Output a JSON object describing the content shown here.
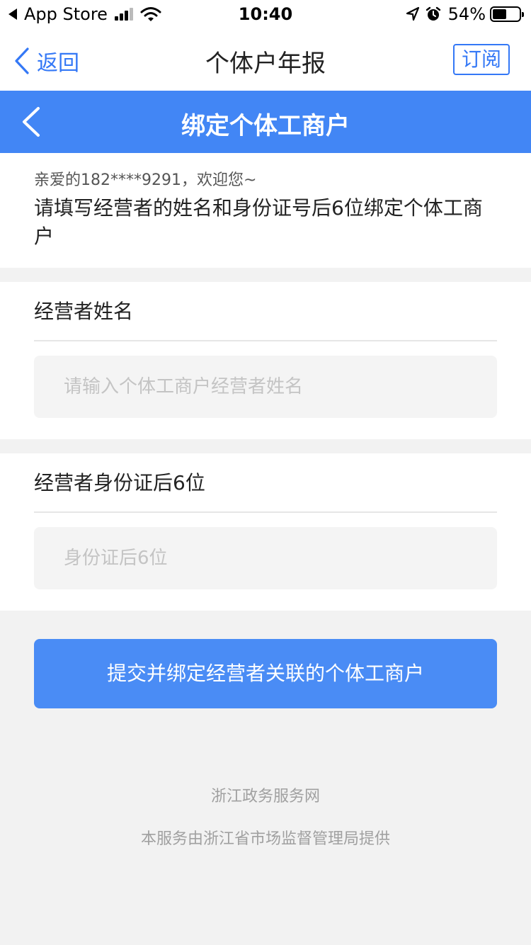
{
  "status_bar": {
    "back_app": "App Store",
    "time": "10:40",
    "battery_percent": "54%",
    "battery_level": 0.54,
    "icons": [
      "signal-icon",
      "wifi-icon",
      "location-icon",
      "alarm-icon",
      "battery-icon"
    ]
  },
  "nav": {
    "back_label": "返回",
    "title": "个体户年报",
    "subscribe_label": "订阅",
    "accent_color": "#3478f6"
  },
  "header": {
    "title": "绑定个体工商户",
    "background_color": "#4286f5"
  },
  "welcome": {
    "greeting": "亲爱的182****9291，欢迎您~",
    "instruction": "请填写经营者的姓名和身份证号后6位绑定个体工商户"
  },
  "form": {
    "name_label": "经营者姓名",
    "name_placeholder": "请输入个体工商户经营者姓名",
    "name_value": "",
    "id_label": "经营者身份证后6位",
    "id_placeholder": "身份证后6位",
    "id_value": ""
  },
  "submit_label": "提交并绑定经营者关联的个体工商户",
  "footer": {
    "site": "浙江政务服务网",
    "provider": "本服务由浙江省市场监督管理局提供"
  }
}
